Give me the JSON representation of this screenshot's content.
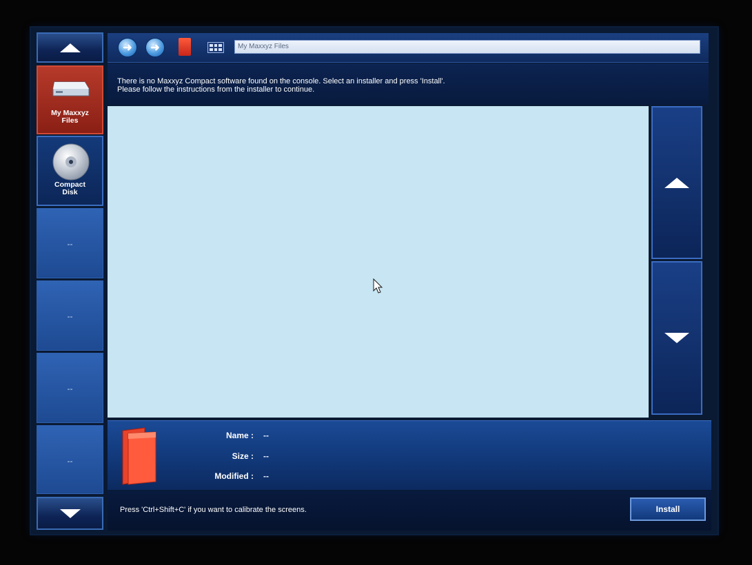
{
  "toolbar": {
    "back_icon": "back-arrow-icon",
    "forward_icon": "forward-arrow-icon",
    "address": "My Maxxyz Files"
  },
  "message": {
    "line1": "There is no Maxxyz Compact software found on the console. Select an installer and press 'Install'.",
    "line2": "Please follow the instructions from the installer to continue."
  },
  "sidebar": {
    "items": [
      {
        "label_line1": "My Maxxyz",
        "label_line2": "Files",
        "icon": "drive-icon",
        "selected": true
      },
      {
        "label_line1": "Compact",
        "label_line2": "Disk",
        "icon": "cd-icon",
        "selected": false
      },
      {
        "label": "--"
      },
      {
        "label": "--"
      },
      {
        "label": "--"
      },
      {
        "label": "--"
      }
    ]
  },
  "details": {
    "name_label": "Name :",
    "name_value": "--",
    "size_label": "Size :",
    "size_value": "--",
    "modified_label": "Modified :",
    "modified_value": "--"
  },
  "status": {
    "text": "Press 'Ctrl+Shift+C' if you want to calibrate the screens.",
    "install_label": "Install"
  },
  "colors": {
    "content_bg": "#c7e5f2",
    "selected_item": "#b63a2a",
    "panel_blue": "#1b4a96"
  }
}
